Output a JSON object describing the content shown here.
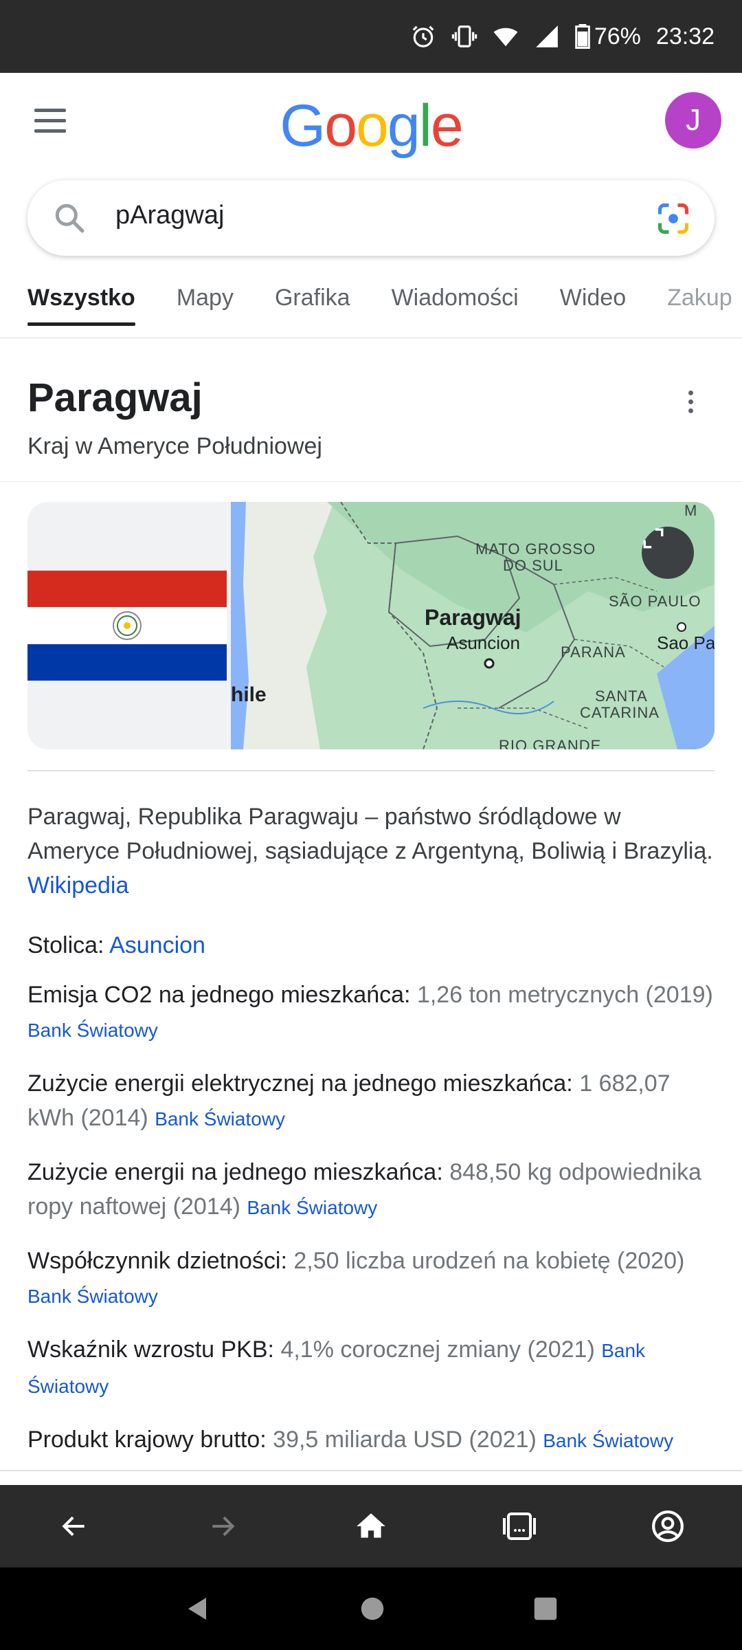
{
  "status_bar": {
    "battery": "76%",
    "time": "23:32"
  },
  "header": {
    "logo_letters": [
      "G",
      "o",
      "o",
      "g",
      "l",
      "e"
    ],
    "avatar_initial": "J"
  },
  "search": {
    "query": "pAragwaj"
  },
  "tabs": [
    {
      "label": "Wszystko",
      "active": true
    },
    {
      "label": "Mapy",
      "active": false
    },
    {
      "label": "Grafika",
      "active": false
    },
    {
      "label": "Wiadomości",
      "active": false
    },
    {
      "label": "Wideo",
      "active": false
    },
    {
      "label": "Zakup",
      "active": false
    }
  ],
  "knowledge_panel": {
    "title": "Paragwaj",
    "subtitle": "Kraj w Ameryce Południowej",
    "map_labels": {
      "mato_grosso_1": "MATO GROSSO",
      "mato_grosso_2": "DO SUL",
      "paragwaj": "Paragwaj",
      "asuncion": "Asuncion",
      "sao_paulo_state": "SÃO PAULO",
      "parana": "PARANA",
      "sao_paulo_city": "Sao Pa",
      "santa": "SANTA",
      "catarina": "CATARINA",
      "chile": "hile",
      "rio_grande": "RIO GRANDE",
      "top_right": "M"
    },
    "description": "Paragwaj, Republika Paragwaju – państwo śródlądowe w Ameryce Południowej, sąsiadujące z Argentyną, Boliwią i Brazylią.",
    "description_source": "Wikipedia",
    "facts": [
      {
        "label": "Stolica:",
        "value": "",
        "link": "Asuncion",
        "source": ""
      },
      {
        "label": "Emisja CO2 na jednego mieszkańca:",
        "value": "1,26 ton metrycznych (2019)",
        "link": "",
        "source": "Bank Światowy"
      },
      {
        "label": "Zużycie energii elektrycznej na jednego mieszkańca:",
        "value": "1 682,07 kWh (2014)",
        "link": "",
        "source": "Bank Światowy"
      },
      {
        "label": "Zużycie energii na jednego mieszkańca:",
        "value": "848,50 kg odpowiednika ropy naftowej (2014)",
        "link": "",
        "source": "Bank Światowy"
      },
      {
        "label": "Współczynnik dzietności:",
        "value": "2,50 liczba urodzeń na kobietę (2020)",
        "link": "",
        "source": "Bank Światowy"
      },
      {
        "label": "Wskaźnik wzrostu PKB:",
        "value": "4,1% corocznej zmiany (2021)",
        "link": "",
        "source": "Bank Światowy"
      },
      {
        "label": "Produkt krajowy brutto:",
        "value": "39,5 miliarda USD (2021)",
        "link": "",
        "source": "Bank Światowy"
      }
    ]
  },
  "browser_nav": [
    "back-icon",
    "forward-icon",
    "home-icon",
    "tabs-icon",
    "account-icon"
  ],
  "system_nav": [
    "back-triangle-icon",
    "home-circle-icon",
    "recents-square-icon"
  ]
}
